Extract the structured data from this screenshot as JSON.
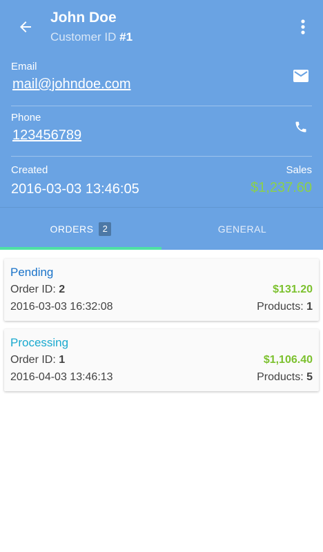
{
  "appbar": {
    "title": "John Doe",
    "subtitle_prefix": "Customer ID ",
    "customer_id": "#1",
    "back_icon": "arrow-left-icon",
    "menu_icon": "more-vertical-icon"
  },
  "contact": {
    "email_label": "Email",
    "email_value": "mail@johndoe.com",
    "email_icon": "envelope-icon",
    "phone_label": "Phone",
    "phone_value": "123456789",
    "phone_icon": "phone-icon"
  },
  "summary": {
    "created_label": "Created",
    "created_value": "2016-03-03 13:46:05",
    "sales_label": "Sales",
    "sales_value": "$1,237.60"
  },
  "tabs": [
    {
      "label": "ORDERS",
      "badge": "2",
      "active": true
    },
    {
      "label": "GENERAL",
      "active": false
    }
  ],
  "orders": [
    {
      "status": "Pending",
      "status_color": "#1a73c9",
      "order_id_label": "Order ID: ",
      "order_id": "2",
      "date": "2016-03-03 16:32:08",
      "amount": "$131.20",
      "products_label": "Products: ",
      "products": "1"
    },
    {
      "status": "Processing",
      "status_color": "#19a9cf",
      "order_id_label": "Order ID: ",
      "order_id": "1",
      "date": "2016-04-03 13:46:13",
      "amount": "$1,106.40",
      "products_label": "Products: ",
      "products": "5"
    }
  ],
  "colors": {
    "header": "#6aa3e3",
    "sales_green": "#8bd14a",
    "amount_green": "#7cc12e",
    "tab_indicator": "#4fe0a4"
  }
}
